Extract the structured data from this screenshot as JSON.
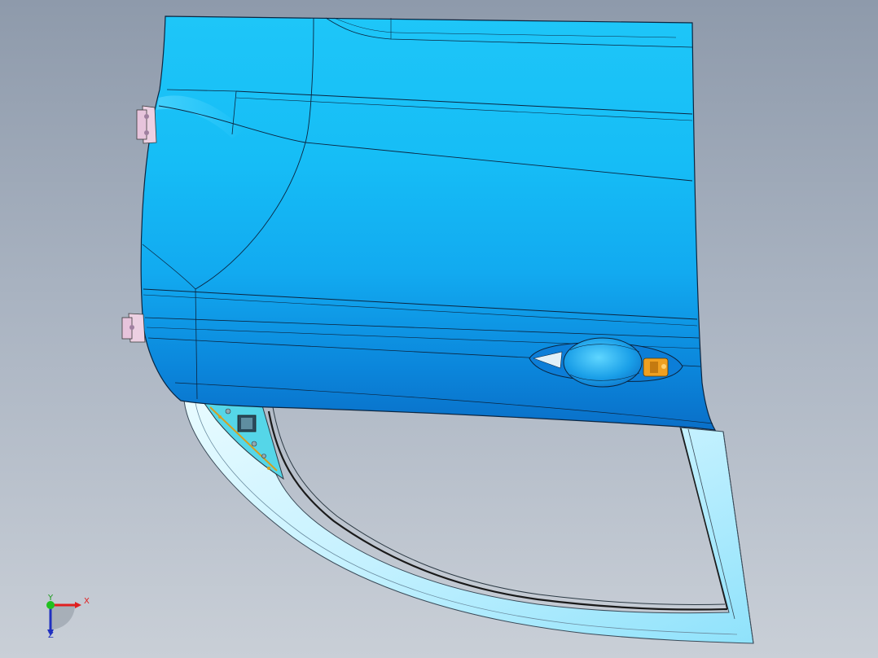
{
  "viewport": {
    "background_top": "#8e9aab",
    "background_bottom": "#c9cfd7"
  },
  "model": {
    "panel_color": "#17b8f0",
    "panel_dark": "#0a7fd6",
    "frame_color": "#bff0ff",
    "hinge_color": "#e7c4dc",
    "latch_color": "#f0a020"
  },
  "triad": {
    "x_label": "X",
    "y_label": "Y",
    "z_label": "Z",
    "x_color": "#e02020",
    "y_color": "#20c020",
    "z_color": "#2030c0"
  }
}
